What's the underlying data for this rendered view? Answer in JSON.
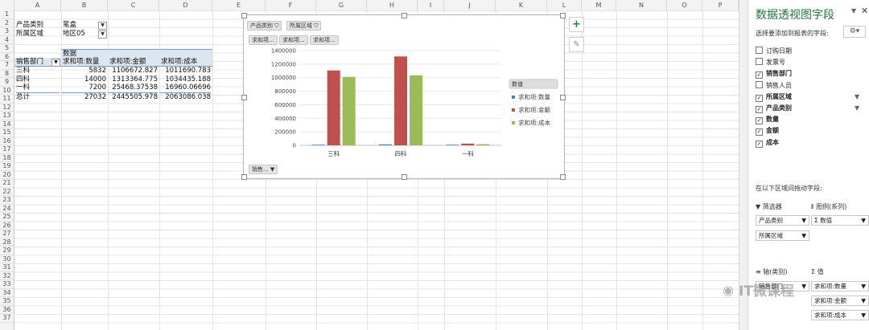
{
  "columns": [
    "A",
    "B",
    "C",
    "D",
    "E",
    "F",
    "G",
    "H",
    "I",
    "J",
    "K",
    "L",
    "M",
    "N",
    "O",
    "P",
    "Q"
  ],
  "rows": [
    "1",
    "2",
    "3",
    "4",
    "5",
    "6",
    "7",
    "8",
    "9",
    "10",
    "11",
    "12",
    "13",
    "14",
    "15",
    "16",
    "17",
    "18",
    "19",
    "20",
    "21",
    "22",
    "23",
    "24",
    "25",
    "26",
    "27",
    "28",
    "29",
    "30",
    "31",
    "32",
    "33",
    "34",
    "35",
    "36",
    "37"
  ],
  "pivot": {
    "filter1_label": "产品类别",
    "filter1_value": "笔盒",
    "filter2_label": "所属区域",
    "filter2_value": "地区05",
    "data_header": "数据",
    "row_field": "销售部门",
    "col_headers": [
      "求和项:数量",
      "求和项:金额",
      "求和项:成本"
    ],
    "body": [
      {
        "name": "三科",
        "v1": "5832",
        "v2": "1106672.827",
        "v3": "1011690.783"
      },
      {
        "name": "四科",
        "v1": "14000",
        "v2": "1313364.775",
        "v3": "1034435.188"
      },
      {
        "name": "一科",
        "v1": "7200",
        "v2": "25468.37538",
        "v3": "16960.06696"
      },
      {
        "name": "总计",
        "v1": "27032",
        "v2": "2445505.978",
        "v3": "2063086.038"
      }
    ]
  },
  "chart_buttons": {
    "filter1": "产品类别",
    "filter2": "所属区域",
    "value1": "求和项...",
    "value2": "求和项...",
    "value3": "求和项...",
    "axis": "销售..."
  },
  "chart_data": {
    "type": "bar",
    "categories": [
      "三科",
      "四科",
      "一科"
    ],
    "series": [
      {
        "name": "求和项:数量",
        "values": [
          5832,
          14000,
          7200
        ],
        "color": "#4f81bd"
      },
      {
        "name": "求和项:金额",
        "values": [
          1106672.827,
          1313364.775,
          25468.37538
        ],
        "color": "#c0504d"
      },
      {
        "name": "求和项:成本",
        "values": [
          1011690.783,
          1034435.188,
          16960.06696
        ],
        "color": "#9bbb59"
      }
    ],
    "yticks": [
      "0",
      "200000",
      "400000",
      "600000",
      "800000",
      "1000000",
      "1200000",
      "1400000"
    ],
    "ylim": [
      0,
      1400000
    ],
    "legend_title": "数值",
    "legend_position": "right",
    "grid": true
  },
  "pane": {
    "title": "数据透视图字段",
    "subtitle": "选择要添加到报表的字段:",
    "fields": [
      {
        "label": "订购日期",
        "checked": false,
        "bold": false,
        "filter": false
      },
      {
        "label": "发票号",
        "checked": false,
        "bold": false,
        "filter": false
      },
      {
        "label": "销售部门",
        "checked": true,
        "bold": true,
        "filter": false
      },
      {
        "label": "销售人员",
        "checked": false,
        "bold": false,
        "filter": false
      },
      {
        "label": "所属区域",
        "checked": true,
        "bold": true,
        "filter": true
      },
      {
        "label": "产品类别",
        "checked": true,
        "bold": true,
        "filter": true
      },
      {
        "label": "数量",
        "checked": true,
        "bold": true,
        "filter": false
      },
      {
        "label": "金额",
        "checked": true,
        "bold": true,
        "filter": false
      },
      {
        "label": "成本",
        "checked": true,
        "bold": true,
        "filter": false
      }
    ],
    "drag_hint": "在以下区域间拖动字段:",
    "area_filters": "筛选器",
    "area_legend": "图例(系列)",
    "area_axis": "轴(类别)",
    "area_values": "值",
    "filter_pills": [
      "产品类别",
      "所属区域"
    ],
    "legend_pill": "Σ 数值",
    "axis_pill": "销售部门",
    "value_pills": [
      "求和项:数量",
      "求和项:金额",
      "求和项:成本"
    ]
  },
  "watermark": "IT微课程"
}
